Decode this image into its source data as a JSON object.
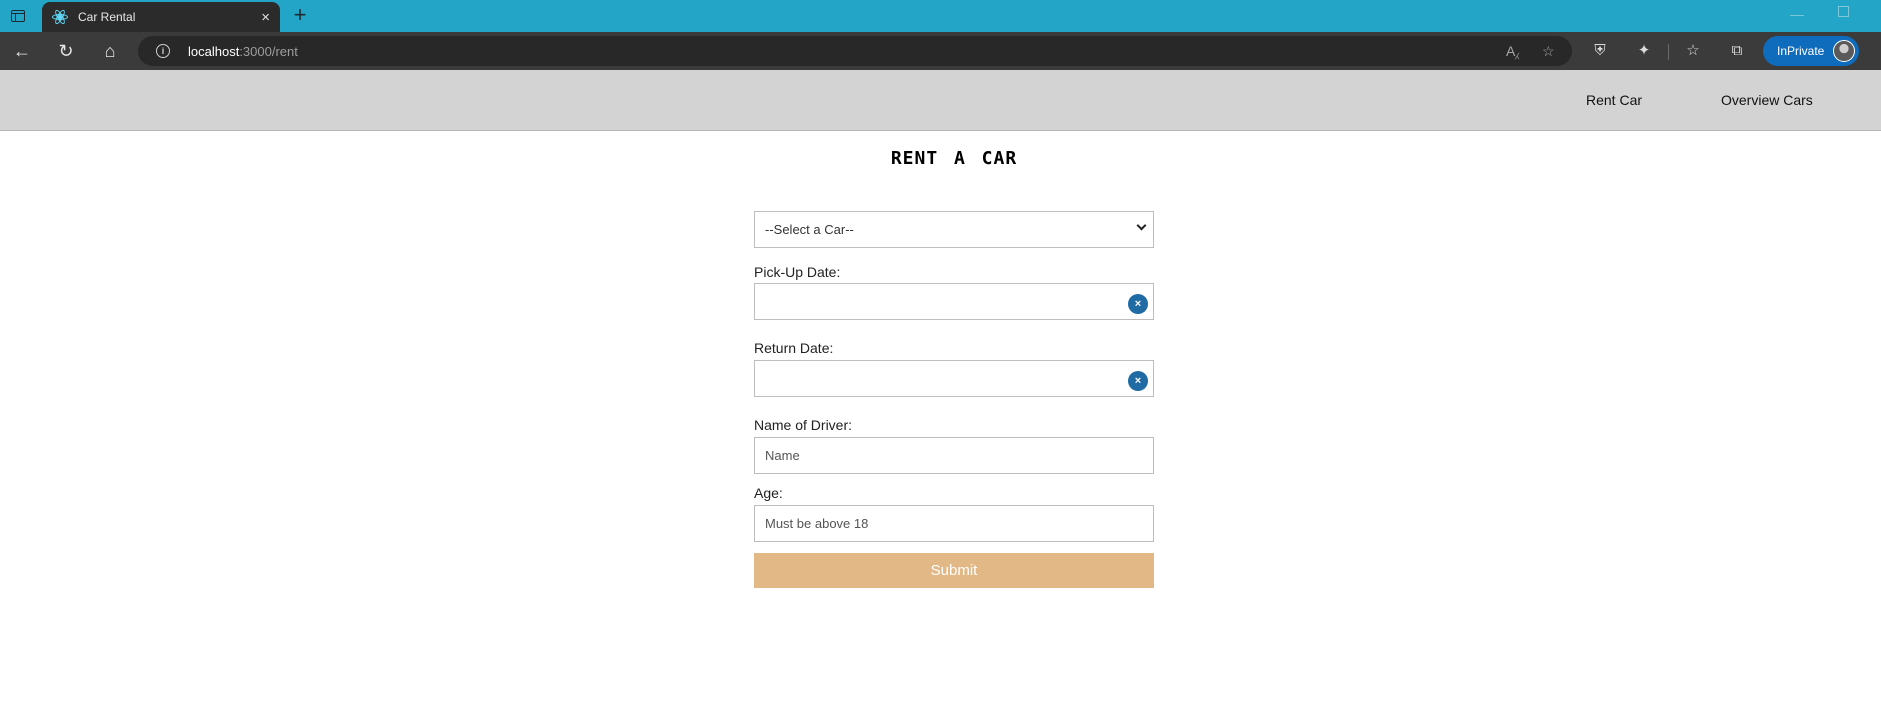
{
  "browser": {
    "tab_title": "Car Rental",
    "tab_close": "×",
    "new_tab": "+",
    "url_host": "localhost",
    "url_path": ":3000/rent",
    "inprivate_label": "InPrivate",
    "icons": [
      "tab-actions-icon",
      "react-favicon-icon",
      "back-icon",
      "refresh-icon",
      "home-icon",
      "info-icon",
      "read-aloud-icon",
      "favorite-add-icon",
      "shield-icon",
      "extensions-icon",
      "favorites-icon",
      "collections-icon"
    ]
  },
  "nav": {
    "rent_car": "Rent Car",
    "overview_cars": "Overview Cars"
  },
  "page": {
    "heading": "RENT A CAR"
  },
  "form": {
    "car_select": "--Select a Car--",
    "pickup_label": "Pick-Up Date:",
    "pickup_value": "",
    "return_label": "Return Date:",
    "return_value": "",
    "clear_glyph": "×",
    "driver_label": "Name of Driver:",
    "driver_placeholder": "Name",
    "age_label": "Age:",
    "age_placeholder": "Must be above 18",
    "submit_label": "Submit"
  },
  "colors": {
    "tabstrip": "#22a5c6",
    "navbar": "#d3d3d3",
    "submit": "#e2b887",
    "clear_button": "#216ba5",
    "inprivate": "#0f6cbd"
  }
}
